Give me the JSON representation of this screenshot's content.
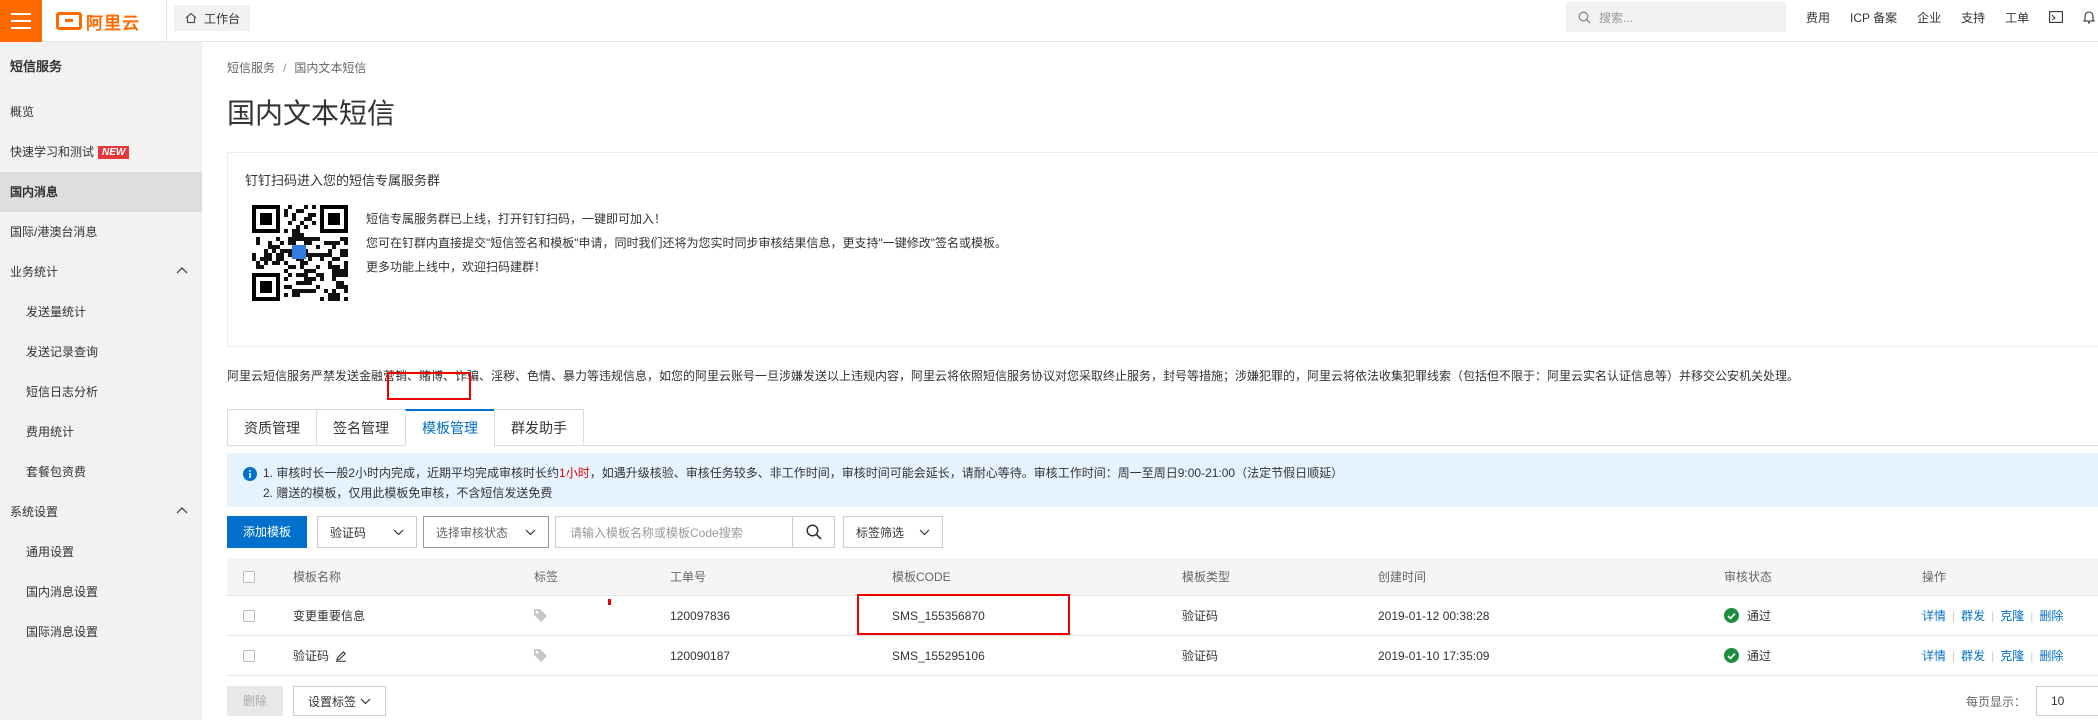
{
  "topbar": {
    "brand": "阿里云",
    "workbench": "工作台",
    "search_placeholder": "搜索...",
    "links": [
      "费用",
      "ICP 备案",
      "企业",
      "支持",
      "工单"
    ]
  },
  "sidebar": {
    "title": "短信服务",
    "items": [
      {
        "label": "概览"
      },
      {
        "label": "快速学习和测试",
        "badge": "NEW"
      },
      {
        "label": "国内消息"
      },
      {
        "label": "国际/港澳台消息"
      },
      {
        "label": "业务统计"
      },
      {
        "label": "发送量统计"
      },
      {
        "label": "发送记录查询"
      },
      {
        "label": "短信日志分析"
      },
      {
        "label": "费用统计"
      },
      {
        "label": "套餐包资费"
      },
      {
        "label": "系统设置"
      },
      {
        "label": "通用设置"
      },
      {
        "label": "国内消息设置"
      },
      {
        "label": "国际消息设置"
      }
    ]
  },
  "breadcrumb": {
    "root": "短信服务",
    "separator": "/",
    "current": "国内文本短信"
  },
  "page_title": "国内文本短信",
  "qr_card": {
    "title": "钉钉扫码进入您的短信专属服务群",
    "lines": [
      "短信专属服务群已上线，打开钉钉扫码，一键即可加入！",
      "您可在钉群内直接提交\"短信签名和模板\"申请，同时我们还将为您实时同步审核结果信息，更支持\"一键修改\"签名或模板。",
      "更多功能上线中，欢迎扫码建群！"
    ]
  },
  "warning": "阿里云短信服务严禁发送金融营销、赌博、诈骗、淫秽、色情、暴力等违规信息，如您的阿里云账号一旦涉嫌发送以上违规内容，阿里云将依照短信服务协议对您采取终止服务，封号等措施；涉嫌犯罪的，阿里云将依法收集犯罪线索（包括但不限于：阿里云实名认证信息等）并移交公安机关处理。",
  "tabs": [
    "资质管理",
    "签名管理",
    "模板管理",
    "群发助手"
  ],
  "notice": {
    "line1_pre": "1. 审核时长一般2小时内完成，近期平均完成审核时长约",
    "line1_hl": "1小时",
    "line1_post": "，如遇升级核验、审核任务较多、非工作时间，审核时间可能会延长，请耐心等待。审核工作时间：周一至周日9:00-21:00（法定节假日顺延）",
    "line2": "2. 赠送的模板，仅用此模板免审核，不含短信发送免费"
  },
  "toolbar": {
    "add_button": "添加模板",
    "type_select": "验证码",
    "status_select": "选择审核状态",
    "search_placeholder": "请输入模板名称或模板Code搜索",
    "tag_filter": "标签筛选"
  },
  "table": {
    "columns": [
      "模板名称",
      "标签",
      "工单号",
      "模板CODE",
      "模板类型",
      "创建时间",
      "审核状态",
      "操作"
    ],
    "rows": [
      {
        "name": "变更重要信息",
        "ticket": "120097836",
        "code": "SMS_155356870",
        "type": "验证码",
        "created": "2019-01-12 00:38:28",
        "status": "通过"
      },
      {
        "name": "验证码",
        "ticket": "120090187",
        "code": "SMS_155295106",
        "type": "验证码",
        "created": "2019-01-10 17:35:09",
        "status": "通过"
      }
    ],
    "ops": [
      "详情",
      "群发",
      "克隆",
      "删除"
    ]
  },
  "footer": {
    "delete_button": "删除",
    "set_tag_button": "设置标签",
    "per_page_label": "每页显示：",
    "per_page_value": "10"
  },
  "colors": {
    "brand": "#ff6a00",
    "primary": "#0070cc",
    "highlight_box": "#ee0000",
    "success": "#1e8e3e"
  }
}
